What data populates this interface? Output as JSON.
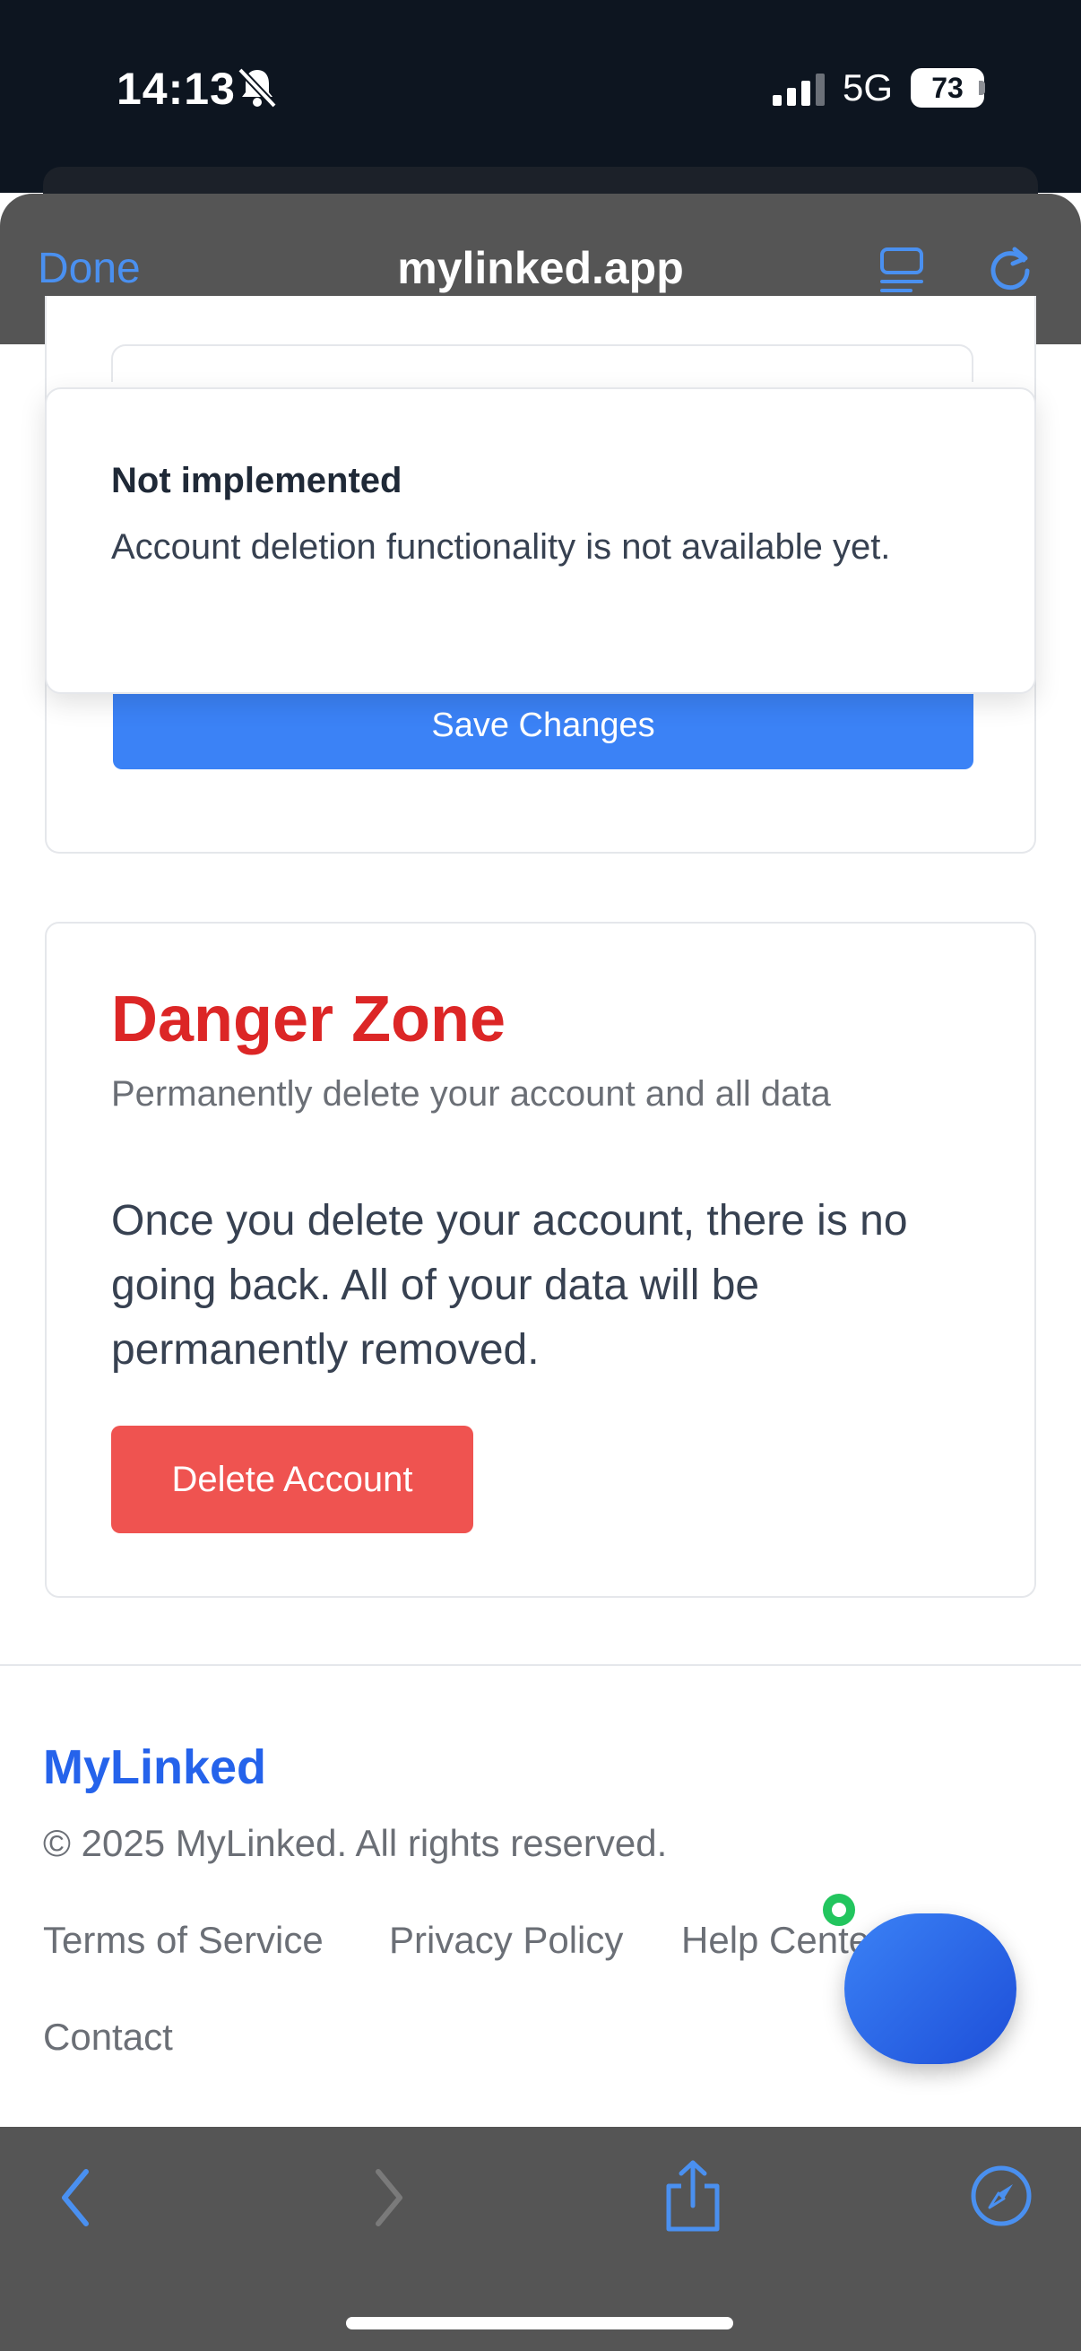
{
  "status_bar": {
    "time": "14:13",
    "network": "5G",
    "battery": "73",
    "icons": [
      "bell-slash-icon",
      "signal-icon",
      "battery-icon"
    ]
  },
  "browser": {
    "done_label": "Done",
    "url": "mylinked.app",
    "toolbar_icons": [
      "reader-icon",
      "reload-icon",
      "back-icon",
      "forward-icon",
      "share-icon",
      "compass-icon"
    ]
  },
  "settings_form": {
    "save_label": "Save Changes"
  },
  "toast": {
    "title": "Not implemented",
    "message": "Account deletion functionality is not available yet."
  },
  "danger_zone": {
    "title": "Danger Zone",
    "subtitle": "Permanently delete your account and all data",
    "warning": "Once you delete your account, there is no going back. All of your data will be permanently removed.",
    "delete_label": "Delete Account"
  },
  "footer": {
    "brand": "MyLinked",
    "copyright": "© 2025 MyLinked. All rights reserved.",
    "links": [
      "Terms of Service",
      "Privacy Policy",
      "Help Center",
      "Contact"
    ]
  },
  "colors": {
    "accent": "#3b82f6",
    "danger": "#dc2626",
    "delete_button": "#ef5350",
    "brand": "#2563eb",
    "online": "#22c55e"
  }
}
